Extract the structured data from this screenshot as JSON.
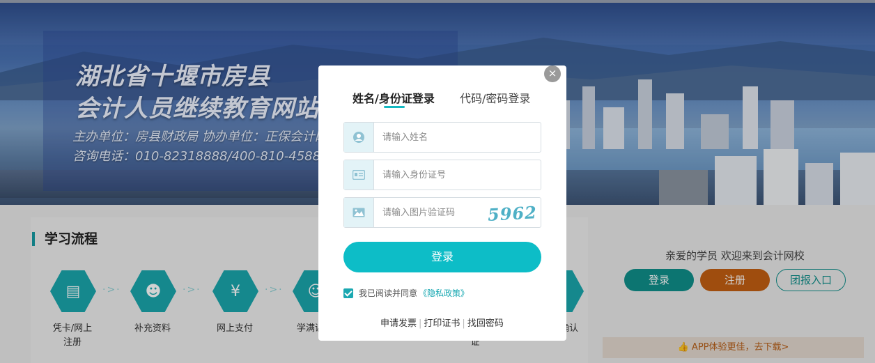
{
  "banner": {
    "title_line1": "湖北省十堰市房县",
    "title_line2": "会计人员继续教育网站",
    "sponsor_line": "主办单位：房县财政局  协办单位：正保会计网校",
    "phone_line": "咨询电话：010-82318888/400-810-4588"
  },
  "section": {
    "title": "学习流程"
  },
  "steps": [
    {
      "label": "凭卡/网上\n注册",
      "icon": "id-card-icon"
    },
    {
      "label": "补充资料",
      "icon": "user-check-icon"
    },
    {
      "label": "网上支付",
      "icon": "money-bag-icon"
    },
    {
      "label": "学满课时",
      "icon": "id-badge-icon"
    },
    {
      "label": "打印证书",
      "icon": "certificate-icon"
    },
    {
      "label": "成绩确认",
      "icon": "search-icon"
    }
  ],
  "step_extra_text": "证",
  "step_extra_text2": "认",
  "sidebar": {
    "welcome": "亲爱的学员 欢迎来到会计网校",
    "login_button": "登录",
    "register_button": "注册",
    "group_button": "团报入口",
    "app_banner": "APP体验更佳，去下载>"
  },
  "modal": {
    "close_label": "×",
    "tab_active": "姓名/身份证登录",
    "tab_other": "代码/密码登录",
    "name_placeholder": "请输入姓名",
    "id_placeholder": "请输入身份证号",
    "captcha_placeholder": "请输入图片验证码",
    "captcha_text": "5962",
    "login_button": "登录",
    "agree_text": "我已阅读并同意",
    "policy_link": "《隐私政策》",
    "link_invoice": "申请发票",
    "link_certificate": "打印证书",
    "link_password": "找回密码"
  },
  "colors": {
    "accent": "#0dbdc7",
    "teal_dark": "#0f8f8a",
    "orange": "#c25f12"
  }
}
